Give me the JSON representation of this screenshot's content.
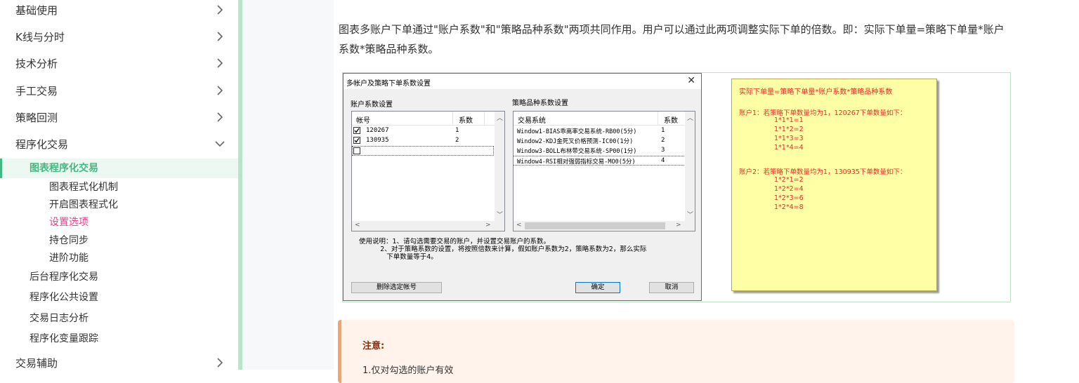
{
  "sidebar": {
    "items": [
      {
        "label": "基础使用"
      },
      {
        "label": "K线与分时"
      },
      {
        "label": "技术分析"
      },
      {
        "label": "手工交易"
      },
      {
        "label": "策略回测"
      },
      {
        "label": "程序化交易"
      }
    ],
    "active_label": "图表程序化交易",
    "sub_items": [
      "图表程式化机制",
      "开启图表程式化",
      "设置选项",
      "持仓同步",
      "进阶功能"
    ],
    "active_sub": "设置选项",
    "level2_items": [
      "后台程序化交易",
      "程序化公共设置",
      "交易日志分析",
      "程序化变量跟踪"
    ],
    "bottom_item": "交易辅助",
    "accent_color": "#42b983",
    "active_sub_color": "#e83e8c"
  },
  "main": {
    "paragraph": "图表多账户下单通过\"账户系数\"和\"策略品种系数\"两项共同作用。用户可以通过此两项调整实际下单的倍数。即：实际下单量=策略下单量*账户系数*策略品种系数。"
  },
  "dialog": {
    "title": "多帐户及策略下单系数设置",
    "close": "✕",
    "account_group": "账户系数设置",
    "account_headers": [
      "帐号",
      "系数"
    ],
    "accounts": [
      {
        "id": "120267",
        "coef": "1",
        "checked": true
      },
      {
        "id": "130935",
        "coef": "2",
        "checked": true
      },
      {
        "id": "",
        "coef": "",
        "checked": false
      }
    ],
    "strategy_group": "策略品种系数设置",
    "strategy_headers": [
      "交易系统",
      "系数"
    ],
    "strategies": [
      {
        "name": "Window1-BIAS乖离率交易系统-RB00(5分)",
        "coef": "1"
      },
      {
        "name": "Window2-KDJ金死叉价格预测-IC00(1分)",
        "coef": "2"
      },
      {
        "name": "Window3-BOLL布林带交易系统-SP00(1分)",
        "coef": "3"
      },
      {
        "name": "Window4-RSI相对强弱指标交易-MO0(5分)",
        "coef": "4"
      }
    ],
    "hint": "使用说明：1、请勾选需要交易的账户，并设置交易账户的系数。\n          2、对于策略系数的设置，将按照倍数来计算，假如账户系数为2，策略系数为2，那么实际\n             下单数量等于4。",
    "buttons": {
      "delete": "删除选定帐号",
      "ok": "确定",
      "cancel": "取消"
    }
  },
  "note": {
    "title": "实际下单量=策略下单量*账户系数*策略品种系数",
    "acc1_head": "账户1：若策略下单数量均为1，120267下单数量如下：",
    "acc1_lines": [
      "1*1*1=1",
      "1*1*2=2",
      "1*1*3=3",
      "1*1*4=4"
    ],
    "acc2_head": "账户2：若策略下单数量均为1，130935下单数量如下：",
    "acc2_lines": [
      "1*2*1=2",
      "1*2*2=4",
      "1*2*3=6",
      "1*2*4=8"
    ]
  },
  "warning": {
    "title": "注意:",
    "line1": "1.仅对勾选的账户有效"
  }
}
